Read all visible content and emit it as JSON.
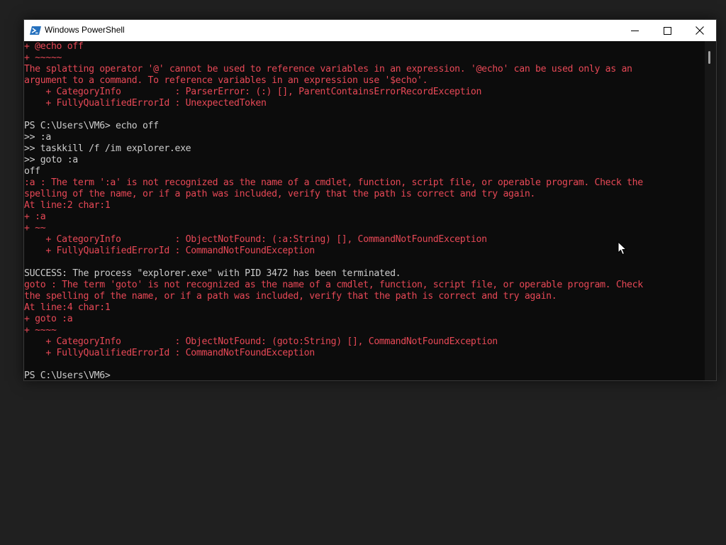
{
  "window": {
    "title": "Windows PowerShell",
    "icon": "powershell-icon",
    "controls": {
      "minimize": "minimize-icon",
      "maximize": "maximize-icon",
      "close": "close-icon"
    }
  },
  "colors": {
    "background": "#0c0c0c",
    "error_text": "#e74856",
    "normal_text": "#cccccc",
    "titlebar": "#ffffff"
  },
  "console": {
    "lines": [
      {
        "type": "error",
        "text": "+ @echo off"
      },
      {
        "type": "error",
        "text": "+ ~~~~~"
      },
      {
        "type": "error",
        "text": "The splatting operator '@' cannot be used to reference variables in an expression. '@echo' can be used only as an"
      },
      {
        "type": "error",
        "text": "argument to a command. To reference variables in an expression use '$echo'."
      },
      {
        "type": "error",
        "text": "    + CategoryInfo          : ParserError: (:) [], ParentContainsErrorRecordException"
      },
      {
        "type": "error",
        "text": "    + FullyQualifiedErrorId : UnexpectedToken"
      },
      {
        "type": "normal",
        "text": ""
      },
      {
        "type": "normal",
        "text": "PS C:\\Users\\VM6> echo off"
      },
      {
        "type": "normal",
        "text": ">> :a"
      },
      {
        "type": "normal",
        "text": ">> taskkill /f /im explorer.exe"
      },
      {
        "type": "normal",
        "text": ">> goto :a"
      },
      {
        "type": "normal",
        "text": "off"
      },
      {
        "type": "error",
        "text": ":a : The term ':a' is not recognized as the name of a cmdlet, function, script file, or operable program. Check the"
      },
      {
        "type": "error",
        "text": "spelling of the name, or if a path was included, verify that the path is correct and try again."
      },
      {
        "type": "error",
        "text": "At line:2 char:1"
      },
      {
        "type": "error",
        "text": "+ :a"
      },
      {
        "type": "error",
        "text": "+ ~~"
      },
      {
        "type": "error",
        "text": "    + CategoryInfo          : ObjectNotFound: (:a:String) [], CommandNotFoundException"
      },
      {
        "type": "error",
        "text": "    + FullyQualifiedErrorId : CommandNotFoundException"
      },
      {
        "type": "normal",
        "text": ""
      },
      {
        "type": "normal",
        "text": "SUCCESS: The process \"explorer.exe\" with PID 3472 has been terminated."
      },
      {
        "type": "error",
        "text": "goto : The term 'goto' is not recognized as the name of a cmdlet, function, script file, or operable program. Check"
      },
      {
        "type": "error",
        "text": "the spelling of the name, or if a path was included, verify that the path is correct and try again."
      },
      {
        "type": "error",
        "text": "At line:4 char:1"
      },
      {
        "type": "error",
        "text": "+ goto :a"
      },
      {
        "type": "error",
        "text": "+ ~~~~"
      },
      {
        "type": "error",
        "text": "    + CategoryInfo          : ObjectNotFound: (goto:String) [], CommandNotFoundException"
      },
      {
        "type": "error",
        "text": "    + FullyQualifiedErrorId : CommandNotFoundException"
      },
      {
        "type": "normal",
        "text": ""
      },
      {
        "type": "normal",
        "text": "PS C:\\Users\\VM6>"
      }
    ]
  },
  "scrollbar": {
    "icon": "scrollbar"
  },
  "cursor": {
    "icon": "mouse-pointer-icon"
  }
}
